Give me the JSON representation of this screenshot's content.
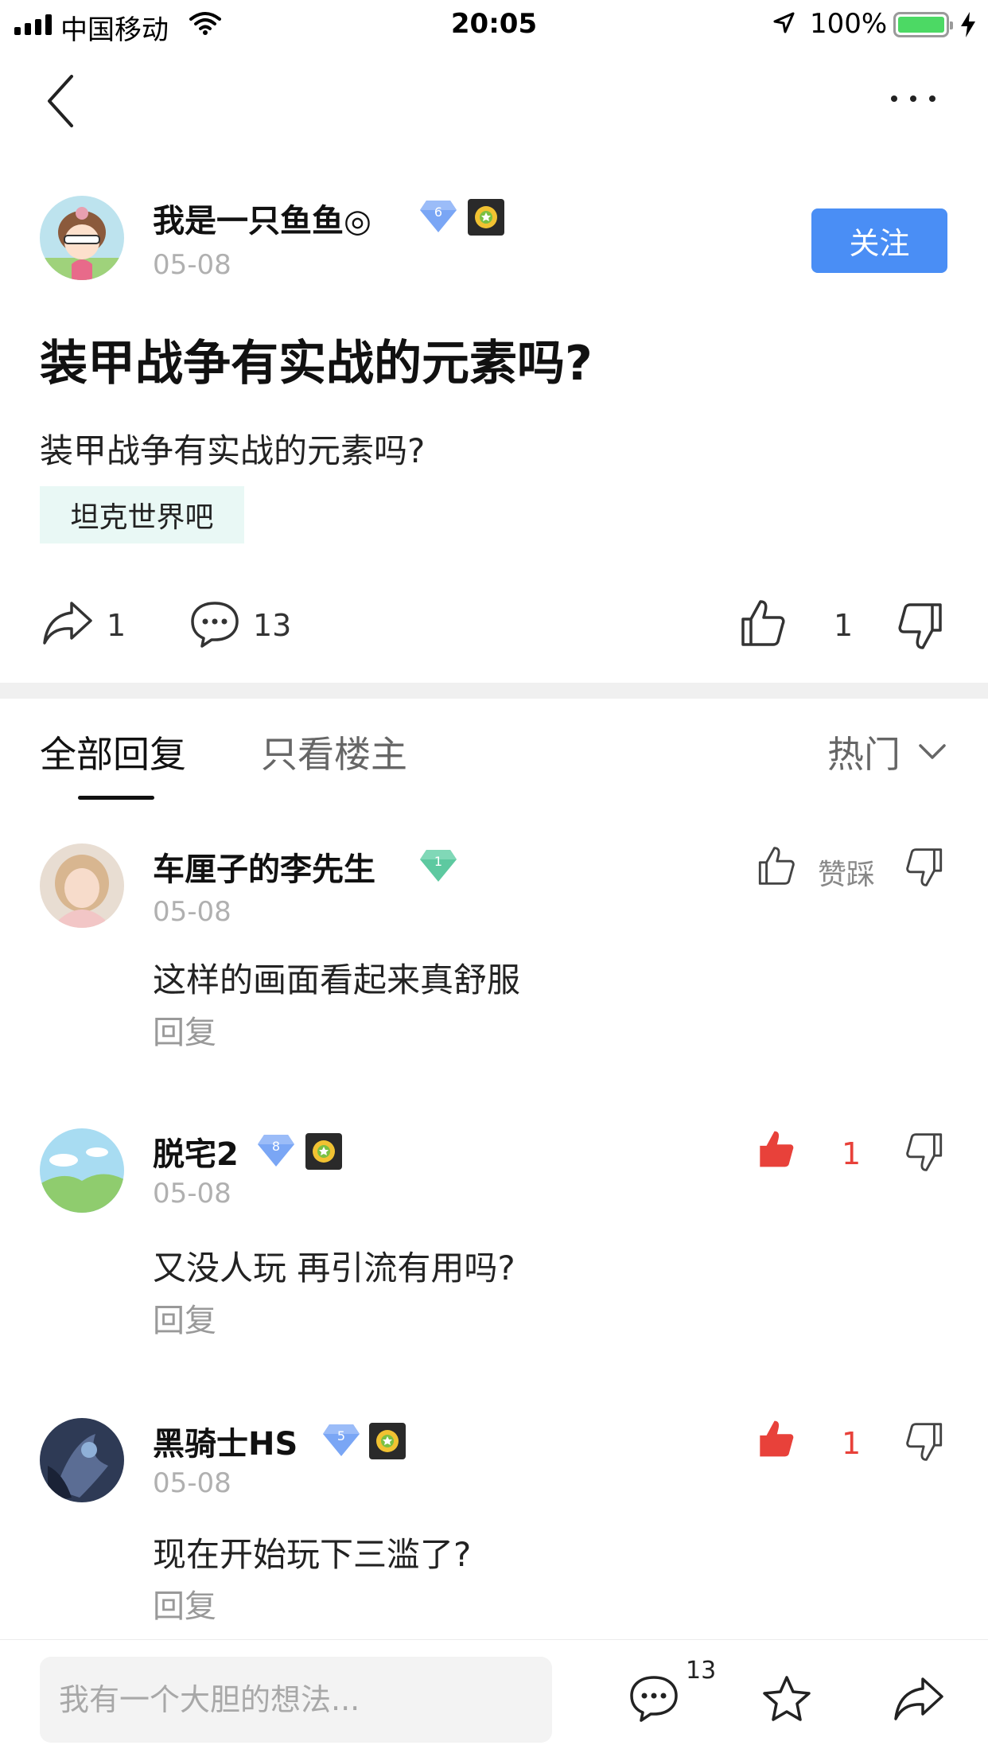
{
  "status_bar": {
    "carrier": "中国移动",
    "time": "20:05",
    "battery": "100%"
  },
  "post": {
    "author": "我是一只鱼鱼◎",
    "author_level": "6",
    "date": "05-08",
    "follow_label": "关注",
    "title": "装甲战争有实战的元素吗?",
    "body": "装甲战争有实战的元素吗?",
    "tag": "坦克世界吧",
    "share_count": "1",
    "comment_count": "13",
    "like_count": "1"
  },
  "tabs": {
    "all": "全部回复",
    "op_only": "只看楼主",
    "sort": "热门"
  },
  "comments": [
    {
      "name": "车厘子的李先生",
      "level": "1",
      "date": "05-08",
      "text": "这样的画面看起来真舒服",
      "reply": "回复",
      "vote_label": "赞踩"
    },
    {
      "name": "脱宅2",
      "level": "8",
      "date": "05-08",
      "text": "又没人玩 再引流有用吗?",
      "reply": "回复",
      "like_count": "1"
    },
    {
      "name": "黑骑士HS",
      "level": "5",
      "date": "05-08",
      "text": "现在开始玩下三滥了?",
      "reply": "回复",
      "like_count": "1"
    }
  ],
  "bottom": {
    "placeholder": "我有一个大胆的想法...",
    "comment_badge": "13"
  },
  "colors": {
    "accent_blue": "#4a8ef5",
    "like_red": "#e8413a",
    "tag_bg": "#e9f8f5"
  }
}
